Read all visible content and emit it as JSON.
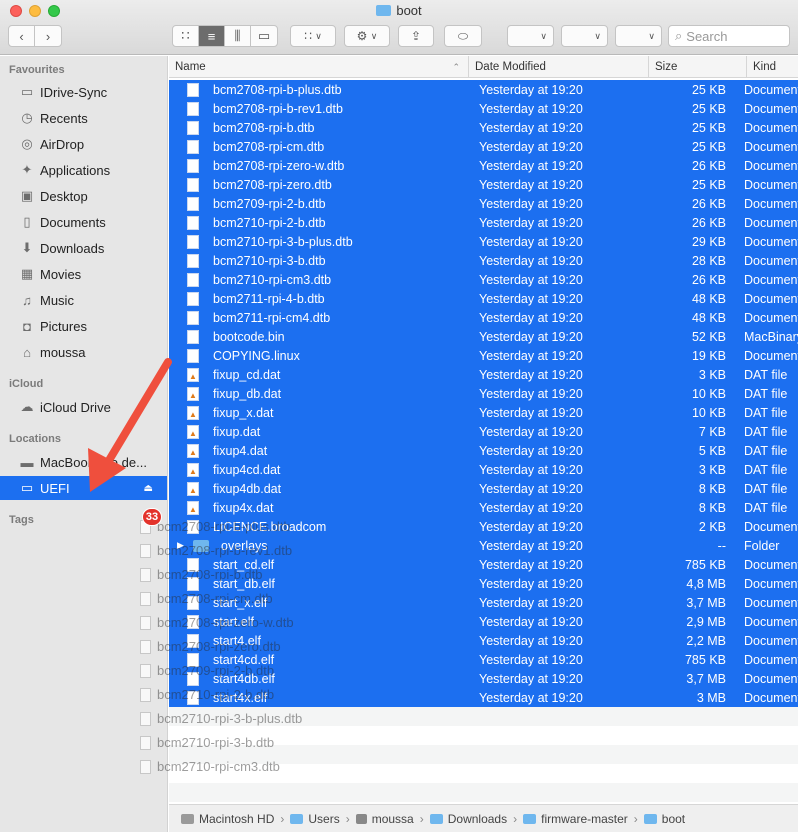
{
  "window": {
    "title": "boot"
  },
  "toolbar": {
    "search_placeholder": "Search",
    "back_icon": "chevron-left-icon",
    "forward_icon": "chevron-right-icon"
  },
  "sidebar": {
    "favourites_header": "Favourites",
    "favourites": [
      {
        "label": "IDrive-Sync",
        "icon": "folder-icon"
      },
      {
        "label": "Recents",
        "icon": "clock-icon"
      },
      {
        "label": "AirDrop",
        "icon": "airdrop-icon"
      },
      {
        "label": "Applications",
        "icon": "applications-icon"
      },
      {
        "label": "Desktop",
        "icon": "desktop-icon"
      },
      {
        "label": "Documents",
        "icon": "document-icon"
      },
      {
        "label": "Downloads",
        "icon": "download-icon"
      },
      {
        "label": "Movies",
        "icon": "film-icon"
      },
      {
        "label": "Music",
        "icon": "music-icon"
      },
      {
        "label": "Pictures",
        "icon": "camera-icon"
      },
      {
        "label": "moussa",
        "icon": "home-icon"
      }
    ],
    "icloud_header": "iCloud",
    "icloud": [
      {
        "label": "iCloud Drive",
        "icon": "cloud-icon"
      }
    ],
    "locations_header": "Locations",
    "locations": [
      {
        "label": "MacBook Pro de...",
        "icon": "laptop-icon"
      },
      {
        "label": "UEFI",
        "icon": "drive-icon",
        "selected": true
      }
    ],
    "tags_header": "Tags"
  },
  "drag": {
    "count": "33",
    "ghost_items": [
      "bcm2708-rpi-b-plus.dtb",
      "bcm2708-rpi-b-rev1.dtb",
      "bcm2708-rpi-b.dtb",
      "bcm2708-rpi-cm.dtb",
      "bcm2708-rpi-zero-w.dtb",
      "bcm2708-rpi-zero.dtb",
      "bcm2709-rpi-2-b.dtb",
      "bcm2710-rpi-2-b.dtb",
      "bcm2710-rpi-3-b-plus.dtb",
      "bcm2710-rpi-3-b.dtb",
      "bcm2710-rpi-cm3.dtb"
    ]
  },
  "columns": {
    "name": "Name",
    "date": "Date Modified",
    "size": "Size",
    "kind": "Kind"
  },
  "files": [
    {
      "name": "bcm2708-rpi-b-plus.dtb",
      "date": "Yesterday at 19:20",
      "size": "25 KB",
      "kind": "Document",
      "type": "doc"
    },
    {
      "name": "bcm2708-rpi-b-rev1.dtb",
      "date": "Yesterday at 19:20",
      "size": "25 KB",
      "kind": "Document",
      "type": "doc"
    },
    {
      "name": "bcm2708-rpi-b.dtb",
      "date": "Yesterday at 19:20",
      "size": "25 KB",
      "kind": "Document",
      "type": "doc"
    },
    {
      "name": "bcm2708-rpi-cm.dtb",
      "date": "Yesterday at 19:20",
      "size": "25 KB",
      "kind": "Document",
      "type": "doc"
    },
    {
      "name": "bcm2708-rpi-zero-w.dtb",
      "date": "Yesterday at 19:20",
      "size": "26 KB",
      "kind": "Document",
      "type": "doc"
    },
    {
      "name": "bcm2708-rpi-zero.dtb",
      "date": "Yesterday at 19:20",
      "size": "25 KB",
      "kind": "Document",
      "type": "doc"
    },
    {
      "name": "bcm2709-rpi-2-b.dtb",
      "date": "Yesterday at 19:20",
      "size": "26 KB",
      "kind": "Document",
      "type": "doc"
    },
    {
      "name": "bcm2710-rpi-2-b.dtb",
      "date": "Yesterday at 19:20",
      "size": "26 KB",
      "kind": "Document",
      "type": "doc"
    },
    {
      "name": "bcm2710-rpi-3-b-plus.dtb",
      "date": "Yesterday at 19:20",
      "size": "29 KB",
      "kind": "Document",
      "type": "doc"
    },
    {
      "name": "bcm2710-rpi-3-b.dtb",
      "date": "Yesterday at 19:20",
      "size": "28 KB",
      "kind": "Document",
      "type": "doc"
    },
    {
      "name": "bcm2710-rpi-cm3.dtb",
      "date": "Yesterday at 19:20",
      "size": "26 KB",
      "kind": "Document",
      "type": "doc"
    },
    {
      "name": "bcm2711-rpi-4-b.dtb",
      "date": "Yesterday at 19:20",
      "size": "48 KB",
      "kind": "Document",
      "type": "doc"
    },
    {
      "name": "bcm2711-rpi-cm4.dtb",
      "date": "Yesterday at 19:20",
      "size": "48 KB",
      "kind": "Document",
      "type": "doc"
    },
    {
      "name": "bootcode.bin",
      "date": "Yesterday at 19:20",
      "size": "52 KB",
      "kind": "MacBinary",
      "type": "doc"
    },
    {
      "name": "COPYING.linux",
      "date": "Yesterday at 19:20",
      "size": "19 KB",
      "kind": "Document",
      "type": "doc"
    },
    {
      "name": "fixup_cd.dat",
      "date": "Yesterday at 19:20",
      "size": "3 KB",
      "kind": "DAT file",
      "type": "dat"
    },
    {
      "name": "fixup_db.dat",
      "date": "Yesterday at 19:20",
      "size": "10 KB",
      "kind": "DAT file",
      "type": "dat"
    },
    {
      "name": "fixup_x.dat",
      "date": "Yesterday at 19:20",
      "size": "10 KB",
      "kind": "DAT file",
      "type": "dat"
    },
    {
      "name": "fixup.dat",
      "date": "Yesterday at 19:20",
      "size": "7 KB",
      "kind": "DAT file",
      "type": "dat"
    },
    {
      "name": "fixup4.dat",
      "date": "Yesterday at 19:20",
      "size": "5 KB",
      "kind": "DAT file",
      "type": "dat"
    },
    {
      "name": "fixup4cd.dat",
      "date": "Yesterday at 19:20",
      "size": "3 KB",
      "kind": "DAT file",
      "type": "dat"
    },
    {
      "name": "fixup4db.dat",
      "date": "Yesterday at 19:20",
      "size": "8 KB",
      "kind": "DAT file",
      "type": "dat"
    },
    {
      "name": "fixup4x.dat",
      "date": "Yesterday at 19:20",
      "size": "8 KB",
      "kind": "DAT file",
      "type": "dat"
    },
    {
      "name": "LICENCE.broadcom",
      "date": "Yesterday at 19:20",
      "size": "2 KB",
      "kind": "Document",
      "type": "doc"
    },
    {
      "name": "overlays",
      "date": "Yesterday at 19:20",
      "size": "--",
      "kind": "Folder",
      "type": "folder"
    },
    {
      "name": "start_cd.elf",
      "date": "Yesterday at 19:20",
      "size": "785 KB",
      "kind": "Document",
      "type": "doc"
    },
    {
      "name": "start_db.elf",
      "date": "Yesterday at 19:20",
      "size": "4,8 MB",
      "kind": "Document",
      "type": "doc"
    },
    {
      "name": "start_x.elf",
      "date": "Yesterday at 19:20",
      "size": "3,7 MB",
      "kind": "Document",
      "type": "doc"
    },
    {
      "name": "start.elf",
      "date": "Yesterday at 19:20",
      "size": "2,9 MB",
      "kind": "Document",
      "type": "doc"
    },
    {
      "name": "start4.elf",
      "date": "Yesterday at 19:20",
      "size": "2,2 MB",
      "kind": "Document",
      "type": "doc"
    },
    {
      "name": "start4cd.elf",
      "date": "Yesterday at 19:20",
      "size": "785 KB",
      "kind": "Document",
      "type": "doc"
    },
    {
      "name": "start4db.elf",
      "date": "Yesterday at 19:20",
      "size": "3,7 MB",
      "kind": "Document",
      "type": "doc"
    },
    {
      "name": "start4x.elf",
      "date": "Yesterday at 19:20",
      "size": "3 MB",
      "kind": "Document",
      "type": "doc"
    }
  ],
  "pathbar": [
    {
      "label": "Macintosh HD",
      "icon": "hard-drive-icon"
    },
    {
      "label": "Users",
      "icon": "folder-icon"
    },
    {
      "label": "moussa",
      "icon": "home-icon"
    },
    {
      "label": "Downloads",
      "icon": "folder-icon"
    },
    {
      "label": "firmware-master",
      "icon": "folder-icon"
    },
    {
      "label": "boot",
      "icon": "folder-icon"
    }
  ],
  "colors": {
    "selection": "#1c6ff0",
    "arrow": "#ef4f3d",
    "badge": "#e3322b"
  }
}
